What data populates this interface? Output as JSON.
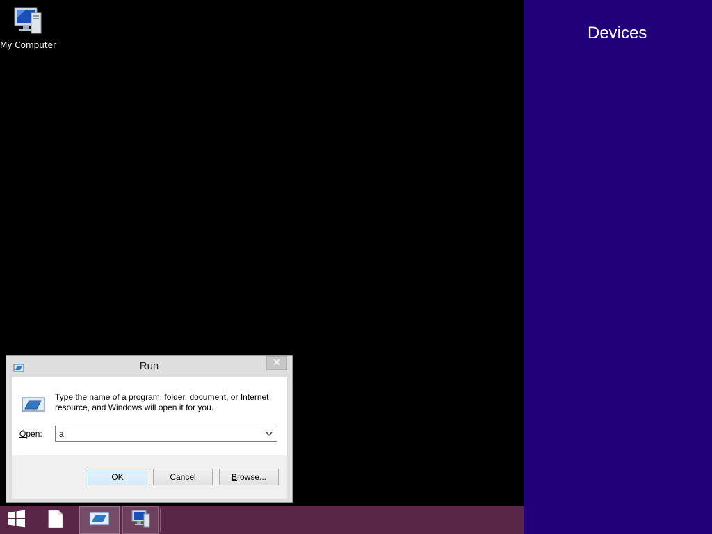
{
  "desktop": {
    "icons": [
      {
        "label": "My Computer",
        "icon": "computer-icon"
      }
    ]
  },
  "charms": {
    "title": "Devices",
    "background": "#22007a"
  },
  "taskbar": {
    "background": "#5a2547",
    "items": [
      {
        "icon": "windows-logo-icon"
      },
      {
        "icon": "file-icon"
      },
      {
        "icon": "run-icon"
      },
      {
        "icon": "computer-icon"
      }
    ]
  },
  "run_dialog": {
    "title": "Run",
    "close_glyph": "✕",
    "description": "Type the name of a program, folder, document, or Internet resource, and Windows will open it for you.",
    "open_label_underlined": "O",
    "open_label_rest": "pen:",
    "open_value": "a",
    "ok_label": "OK",
    "cancel_label": "Cancel",
    "browse_label_underlined": "B",
    "browse_label_rest": "rowse..."
  }
}
